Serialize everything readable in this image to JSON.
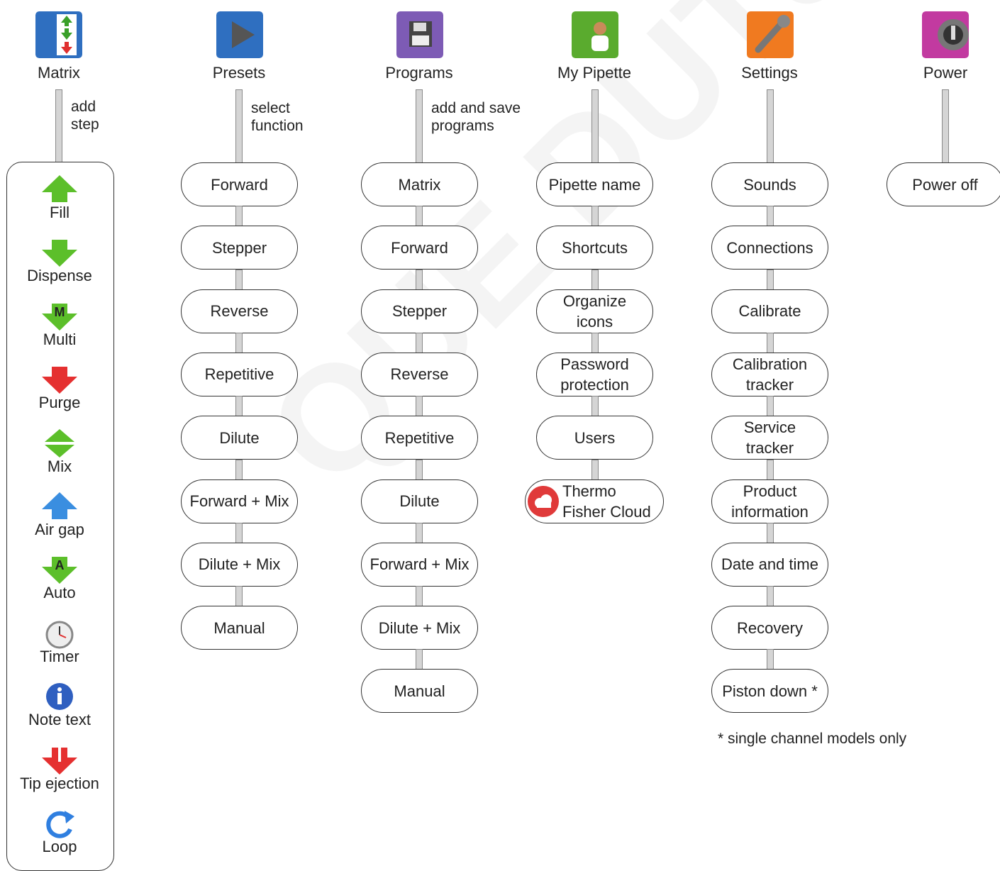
{
  "columns": [
    {
      "id": "matrix",
      "title": "Matrix",
      "note": "add\nstep",
      "accent": "#2f6fc0"
    },
    {
      "id": "presets",
      "title": "Presets",
      "note": "select\nfunction",
      "accent": "#2f6fc0",
      "items": [
        "Forward",
        "Stepper",
        "Reverse",
        "Repetitive",
        "Dilute",
        "Forward + Mix",
        "Dilute + Mix",
        "Manual"
      ]
    },
    {
      "id": "programs",
      "title": "Programs",
      "note": "add and save\nprograms",
      "accent": "#7d5bb5",
      "items": [
        "Matrix",
        "Forward",
        "Stepper",
        "Reverse",
        "Repetitive",
        "Dilute",
        "Forward + Mix",
        "Dilute + Mix",
        "Manual"
      ]
    },
    {
      "id": "my-pipette",
      "title": "My Pipette",
      "accent": "#5aab2e",
      "items": [
        "Pipette name",
        "Shortcuts",
        "Organize\nicons",
        "Password\nprotection",
        "Users",
        "Thermo\nFisher Cloud"
      ]
    },
    {
      "id": "settings",
      "title": "Settings",
      "accent": "#f07a20",
      "items": [
        "Sounds",
        "Connections",
        "Calibrate",
        "Calibration\ntracker",
        "Service\ntracker",
        "Product\ninformation",
        "Date and time",
        "Recovery",
        "Piston down *"
      ]
    },
    {
      "id": "power",
      "title": "Power",
      "accent": "#c23aa0",
      "items": [
        "Power off"
      ]
    }
  ],
  "matrix_steps": [
    {
      "label": "Fill",
      "icon": "fill-arrow-icon",
      "color": "#5cbf2a"
    },
    {
      "label": "Dispense",
      "icon": "dispense-arrow-icon",
      "color": "#5cbf2a"
    },
    {
      "label": "Multi",
      "icon": "multi-arrow-icon",
      "color": "#5cbf2a",
      "letter": "M"
    },
    {
      "label": "Purge",
      "icon": "purge-arrow-icon",
      "color": "#e53030"
    },
    {
      "label": "Mix",
      "icon": "mix-arrows-icon",
      "color": "#5cbf2a"
    },
    {
      "label": "Air gap",
      "icon": "air-gap-arrow-icon",
      "color": "#3a8ee0"
    },
    {
      "label": "Auto",
      "icon": "auto-arrow-icon",
      "color": "#5cbf2a",
      "letter": "A"
    },
    {
      "label": "Timer",
      "icon": "stopwatch-icon",
      "color": "#888888"
    },
    {
      "label": "Note text",
      "icon": "info-icon",
      "color": "#2f5fc0"
    },
    {
      "label": "Tip ejection",
      "icon": "tip-ejection-icon",
      "color": "#e53030"
    },
    {
      "label": "Loop",
      "icon": "loop-icon",
      "color": "#2f7fe0"
    }
  ],
  "footnote": "* single channel models only",
  "watermark": "QUE DUTSCHER SA"
}
